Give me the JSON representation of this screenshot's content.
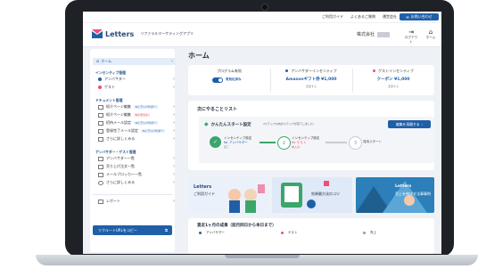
{
  "topbar": {
    "links": [
      "ご利用ガイド",
      "よくあるご質問",
      "運営会社"
    ],
    "contact_label": "お問い合わせ"
  },
  "header": {
    "logo_text": "Letters",
    "logo_subtitle": "リファラルマーケティングアプリ",
    "company_label": "株式会社",
    "logout_label": "ログアウト",
    "home_label": "ホーム"
  },
  "sidebar": {
    "home_label": "ホーム",
    "section_incentive": "インセンティブ管理",
    "incentive_items": [
      "アンバサダー",
      "ゲスト"
    ],
    "section_document": "ドキュメント管理",
    "document_items": [
      {
        "label": "紹介ページ編集",
        "badge": "for アンバサダー",
        "badge_type": "blue"
      },
      {
        "label": "紹介ページ編集",
        "badge": "for ゲスト",
        "badge_type": "red"
      },
      {
        "label": "招待メール設定",
        "badge": "for アンバサダー",
        "badge_type": "blue"
      },
      {
        "label": "登録完了メール設定",
        "badge": "for アンバサダー",
        "badge_type": "blue"
      },
      {
        "label": "さらに詳しくみる",
        "badge": "",
        "badge_type": ""
      }
    ],
    "section_ambassador": "アンバサダー・ゲスト管理",
    "ambassador_items": [
      "アンバサダー一覧",
      "売り上げ注文一覧",
      "メールブロッカー一覧",
      "さらに詳しくみる"
    ],
    "report_label": "レポート",
    "copy_button_label": "リクルートURLをコピー"
  },
  "main": {
    "page_title": "ホーム",
    "program_title": "プログラム有効",
    "program_status": "有効化済み",
    "ambassador_incentive_title": "アンバサダーインセンティブ",
    "ambassador_incentive_value": "Amazonギフト券 ¥1,000",
    "ambassador_incentive_sub": "変更する",
    "guest_incentive_title": "ゲストインセンティブ",
    "guest_incentive_value": "クーポン ¥1,000",
    "guest_incentive_sub": "変更する",
    "todo_title": "次にやることリスト",
    "setup_title": "かんたんスタート設定",
    "setup_note": "3ステップ以内のステップが完了しました！",
    "confirm_button_label": "編集を再開する",
    "steps": [
      {
        "label": "インセンティブ設定",
        "sub_label": "for アンバサダー",
        "status": "完了"
      },
      {
        "label": "インセンティブ設定",
        "sub_label": "for ゲスト",
        "status": "未入力"
      },
      {
        "label": "運用スタート",
        "sub_label": "",
        "status": ""
      }
    ],
    "banners": [
      {
        "logo": "Letters",
        "caption": "ご利用ガイド"
      },
      {
        "caption": "効果最大化のコツ"
      },
      {
        "logo": "Letters",
        "caption": "売上を伸ばす法事事例"
      }
    ],
    "results_title": "直近1ヶ月の成果（前月同日から本日まで）",
    "results_legend": [
      "アンバサダー",
      "ゲスト",
      "売上"
    ]
  },
  "colors": {
    "primary": "#1f5fa8",
    "success": "#3aa66a",
    "warning": "#d9483b",
    "accent_pink": "#f24b7a"
  }
}
